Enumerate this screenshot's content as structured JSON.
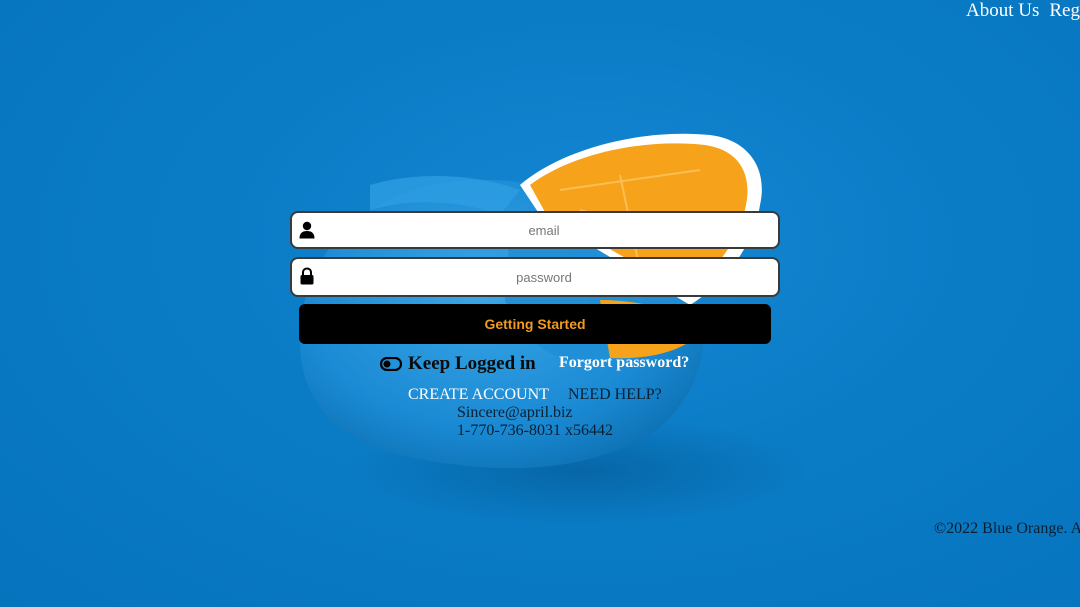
{
  "nav": {
    "about": "About Us",
    "register": "Reg"
  },
  "login": {
    "email_placeholder": "email",
    "password_placeholder": "password",
    "submit_label": "Getting Started",
    "keep_logged_label": "Keep Logged in",
    "forgot_label": "Forgort password?"
  },
  "links": {
    "create_account": "CREATE ACCOUNT",
    "need_help": "NEED HELP?"
  },
  "contact": {
    "email": "Sincere@april.biz",
    "phone": "1-770-736-8031 x56442"
  },
  "footer": {
    "text": "©2022 Blue Orange. A"
  },
  "icons": {
    "email_field": "user-icon",
    "password_field": "lock-icon",
    "keep_logged": "toggle-icon"
  },
  "colors": {
    "background": "#0a7cc6",
    "button_bg": "#000000",
    "button_text": "#f09a1f",
    "orange": "#f7a21b"
  }
}
